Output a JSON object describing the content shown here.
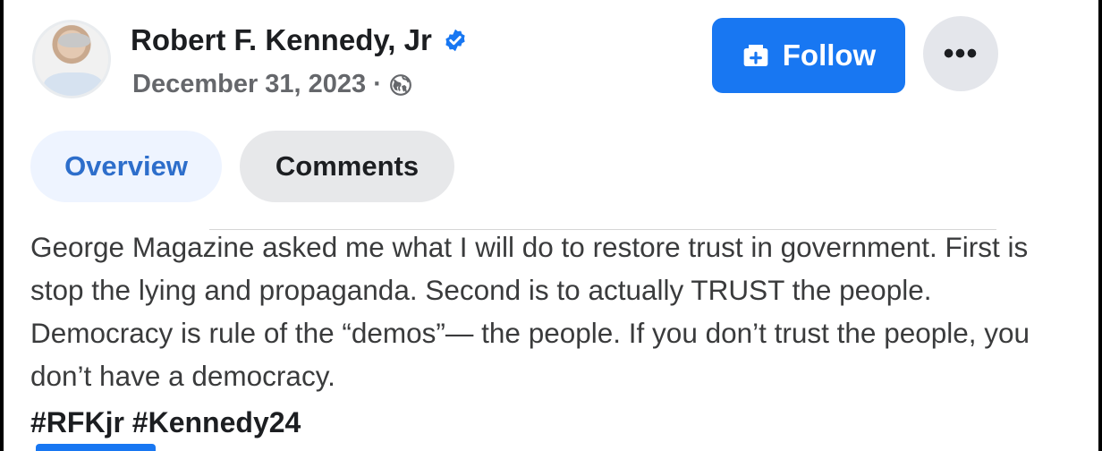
{
  "post": {
    "author": "Robert F. Kennedy, Jr",
    "date": "December 31, 2023",
    "separator": "·",
    "follow_label": "Follow",
    "more_label": "•••",
    "tabs": [
      "Overview",
      "Comments"
    ],
    "body": "George Magazine asked me what I will do to restore trust in government. First is stop the lying and propaganda. Second is to actually TRUST the people. Democracy is rule of the “demos”— the people. If you don’t trust the people, you don’t have a democracy.",
    "hashtags": "#RFKjr #Kennedy24"
  },
  "colors": {
    "accent": "#1877f2",
    "tab_active_text": "#2d6ecb",
    "meta_text": "#65676b"
  },
  "icons": [
    "verified-badge-icon",
    "globe-icon",
    "follow-add-icon",
    "more-options-icon"
  ]
}
